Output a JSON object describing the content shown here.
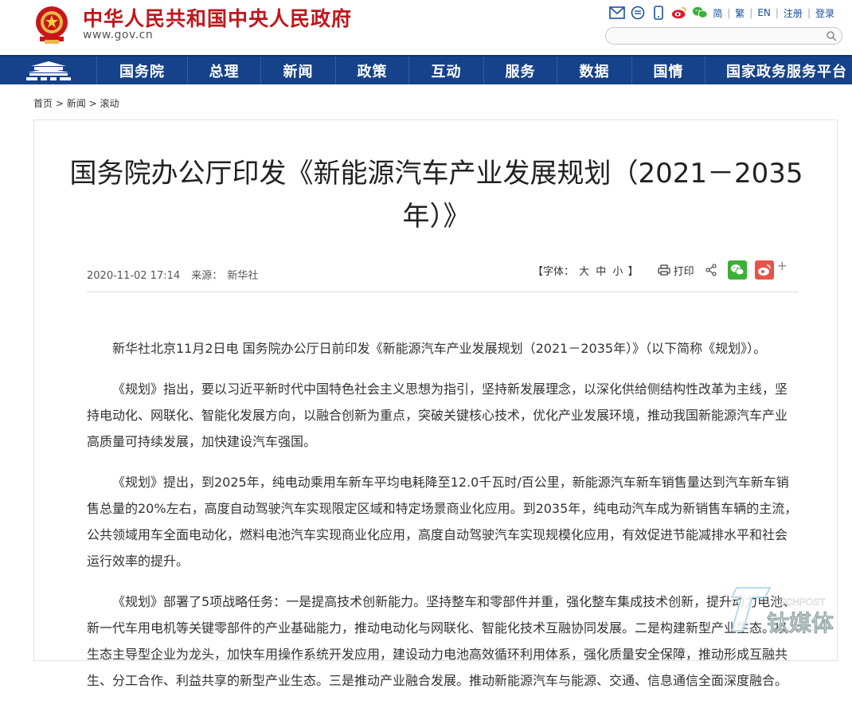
{
  "header": {
    "site_title": "中华人民共和国中央人民政府",
    "site_domain": "www.gov.cn",
    "lang_simplified": "简",
    "lang_traditional": "繁",
    "lang_english": "EN",
    "register": "注册",
    "login": "登录",
    "search_placeholder": ""
  },
  "nav": {
    "items": [
      "国务院",
      "总理",
      "新闻",
      "政策",
      "互动",
      "服务",
      "数据",
      "国情",
      "国家政务服务平台"
    ]
  },
  "breadcrumb": {
    "home": "首页",
    "news": "新闻",
    "rolling": "滚动",
    "separator": ">"
  },
  "article": {
    "title": "国务院办公厅印发《新能源汽车产业发展规划（2021－2035年）》",
    "date": "2020-11-02 17:14",
    "source_label": "来源：",
    "source": "新华社",
    "font_size_label": "【字体：",
    "font_large": "大",
    "font_medium": "中",
    "font_small": "小",
    "font_size_end": "】",
    "print_label": "打印",
    "plus": "+",
    "paragraphs": [
      "新华社北京11月2日电 国务院办公厅日前印发《新能源汽车产业发展规划（2021－2035年）》（以下简称《规划》）。",
      "《规划》指出，要以习近平新时代中国特色社会主义思想为指引，坚持新发展理念，以深化供给侧结构性改革为主线，坚持电动化、网联化、智能化发展方向，以融合创新为重点，突破关键核心技术，优化产业发展环境，推动我国新能源汽车产业高质量可持续发展，加快建设汽车强国。",
      "《规划》提出，到2025年，纯电动乘用车新车平均电耗降至12.0千瓦时/百公里，新能源汽车新车销售量达到汽车新车销售总量的20%左右，高度自动驾驶汽车实现限定区域和特定场景商业化应用。到2035年，纯电动汽车成为新销售车辆的主流，公共领域用车全面电动化，燃料电池汽车实现商业化应用，高度自动驾驶汽车实现规模化应用，有效促进节能减排水平和社会运行效率的提升。",
      "《规划》部署了5项战略任务：一是提高技术创新能力。坚持整车和零部件并重，强化整车集成技术创新，提升动力电池、新一代车用电机等关键零部件的产业基础能力，推动电动化与网联化、智能化技术互融协同发展。二是构建新型产业生态。以生态主导型企业为龙头，加快车用操作系统开发应用，建设动力电池高效循环利用体系，强化质量安全保障，推动形成互融共生、分工合作、利益共享的新型产业生态。三是推动产业融合发展。推动新能源汽车与能源、交通、信息通信全面深度融合。"
    ]
  },
  "watermark": {
    "brand_en": "TECHPOST",
    "brand_cn": "钛媒体"
  }
}
